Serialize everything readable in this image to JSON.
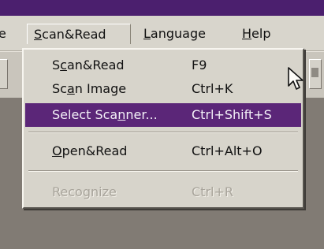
{
  "menubar": {
    "partial_left": "e",
    "items": [
      {
        "label": "Scan&Read",
        "mnemonic": "S",
        "rest": "can&Read"
      },
      {
        "label": "Language",
        "mnemonic": "L",
        "rest": "anguage"
      },
      {
        "label": "Help",
        "mnemonic": "H",
        "rest": "elp"
      }
    ]
  },
  "scan_menu": {
    "items": [
      {
        "label_pre": "S",
        "mnemonic": "c",
        "label_post": "an&Read",
        "shortcut": "F9"
      },
      {
        "label_pre": "Sc",
        "mnemonic": "a",
        "label_post": "n Image",
        "shortcut": "Ctrl+K"
      },
      {
        "label_pre": "Select Sca",
        "mnemonic": "n",
        "label_post": "ner...",
        "shortcut": "Ctrl+Shift+S"
      },
      {
        "label_pre": "",
        "mnemonic": "O",
        "label_post": "pen&Read",
        "shortcut": "Ctrl+Alt+O"
      },
      {
        "label_pre": "",
        "mnemonic": "",
        "label_post": "Recognize",
        "shortcut": "Ctrl+R"
      }
    ]
  },
  "colors": {
    "highlight": "#5b2678",
    "title_bar": "#4b1f6e",
    "menu_background": "#d7d4cb"
  },
  "icons": {
    "cursor": "arrow-pointer-icon"
  }
}
